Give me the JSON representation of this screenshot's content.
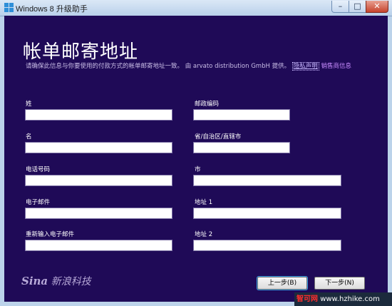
{
  "window": {
    "title": "Windows 8 升级助手",
    "minimize": "–",
    "maximize": "□",
    "close": "✕"
  },
  "page": {
    "heading": "帐单邮寄地址",
    "description": "请确保此信息与你要使用的付款方式的帐单邮寄地址一致。 由 arvato distribution GmbH 提供。",
    "privacy_link": "隐私声明",
    "seller_link": "销售商信息"
  },
  "form": {
    "last_name_label": "姓",
    "first_name_label": "名",
    "phone_label": "电话号码",
    "email_label": "电子邮件",
    "email_confirm_label": "重新输入电子邮件",
    "postal_code_label": "邮政编码",
    "province_label": "省/自治区/直辖市",
    "city_label": "市",
    "address1_label": "地址 1",
    "address2_label": "地址 2"
  },
  "footer": {
    "logo_brand": "Sina",
    "logo_text": "新浪科技",
    "back_button": "上一步(B)",
    "next_button": "下一步(N)",
    "watermark_site": "智可网",
    "watermark_url": "www.hzhike.com"
  },
  "colors": {
    "background": "#1f0a57",
    "link": "#c88cff"
  }
}
